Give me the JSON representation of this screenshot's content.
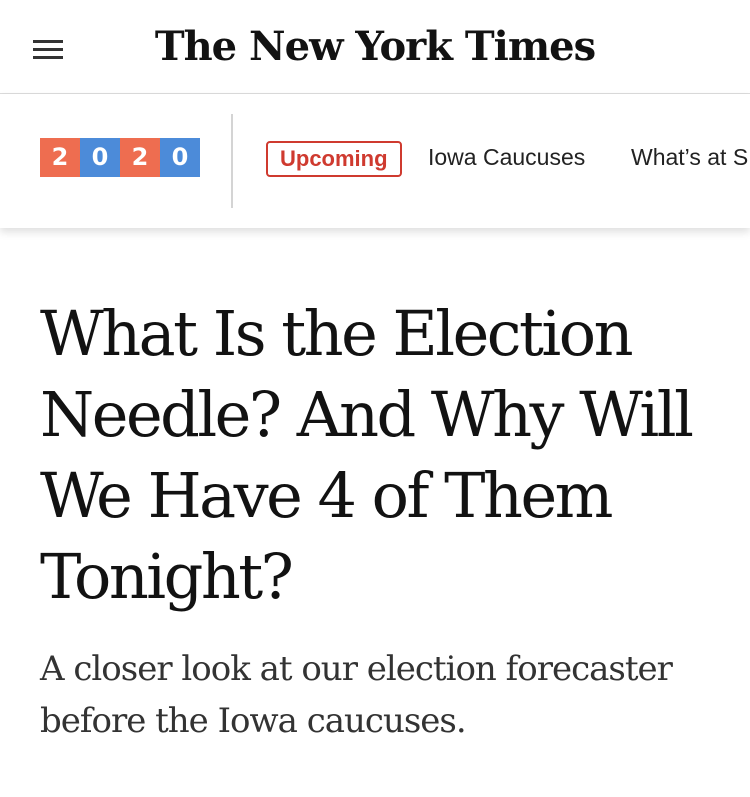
{
  "header": {
    "logo_text": "The New York Times",
    "menu_icon": "hamburger-menu-icon"
  },
  "section_bar": {
    "badge_digits": [
      {
        "text": "2",
        "color": "#ee6d50"
      },
      {
        "text": "0",
        "color": "#4c8bd9"
      },
      {
        "text": "2",
        "color": "#ee6d50"
      },
      {
        "text": "0",
        "color": "#4c8bd9"
      }
    ],
    "upcoming_label": "Upcoming",
    "nav_links": [
      "Iowa Caucuses",
      "What’s at S"
    ]
  },
  "article": {
    "headline": "What Is the Election Needle? And Why Will We Have 4 of Them Tonight?",
    "summary": "A closer look at our election forecaster before the Iowa caucuses."
  },
  "colors": {
    "accent_red": "#cf3a2f",
    "badge_orange": "#ee6d50",
    "badge_blue": "#4c8bd9",
    "text_dark": "#121212"
  }
}
